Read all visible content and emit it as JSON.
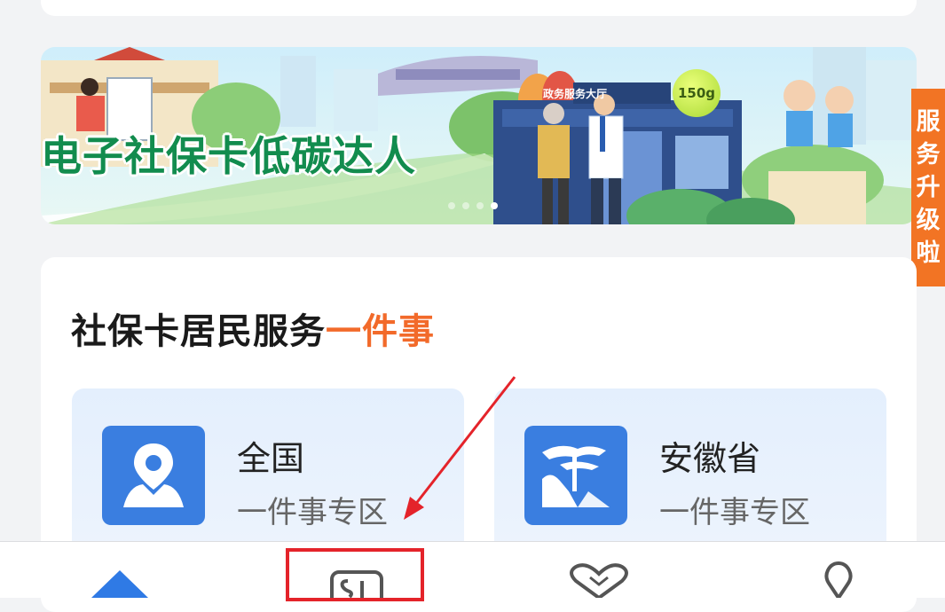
{
  "banner": {
    "title": "电子社保卡低碳达人",
    "hall_sign": "政务服务大厅",
    "weight_badge": "150g",
    "active_slide_index": 3,
    "slide_count": 4
  },
  "side_tab": {
    "label_chars": [
      "服",
      "务",
      "升",
      "级",
      "啦"
    ]
  },
  "section": {
    "title_main": "社保卡居民服务",
    "title_accent": "一件事"
  },
  "zones": [
    {
      "name": "全国",
      "subtitle": "一件事专区",
      "icon": "location-person-icon"
    },
    {
      "name": "安徽省",
      "subtitle": "一件事专区",
      "icon": "huangshan-pine-icon"
    }
  ],
  "bottom_nav": {
    "items": [
      {
        "icon": "home-icon",
        "active": true
      },
      {
        "icon": "si-card-icon",
        "active": false
      },
      {
        "icon": "heart-handshake-icon",
        "active": false
      },
      {
        "icon": "location-pin-icon",
        "active": false
      }
    ]
  },
  "colors": {
    "accent_orange": "#f26a2a",
    "primary_blue": "#3a7ee0",
    "annotation_red": "#e4232a",
    "banner_green": "#128c4e"
  }
}
